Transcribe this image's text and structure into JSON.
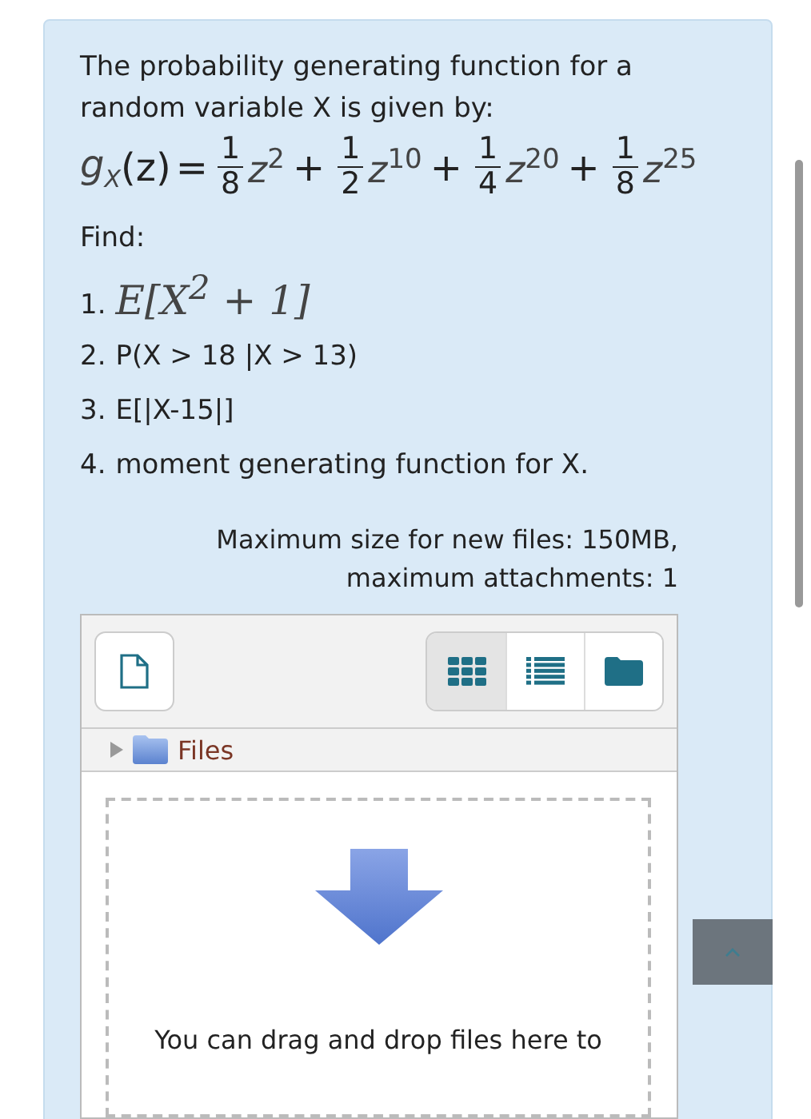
{
  "question": {
    "intro": "The probability generating function for a random variable X is given by:",
    "formula": {
      "func": "g",
      "sub": "X",
      "arg": "(z)",
      "equals": "=",
      "terms": [
        {
          "num": "1",
          "den": "8",
          "base": "z",
          "exp": "2"
        },
        {
          "operator": "+",
          "num": "1",
          "den": "2",
          "base": "z",
          "exp": "10"
        },
        {
          "operator": "+",
          "num": "1",
          "den": "4",
          "base": "z",
          "exp": "20"
        },
        {
          "operator": "+",
          "num": "1",
          "den": "8",
          "base": "z",
          "exp": "25"
        }
      ]
    },
    "find_label": "Find:",
    "items": [
      {
        "kind": "math",
        "number": "1.",
        "text": "E[X$^{2}$ + 1]"
      },
      {
        "kind": "plain",
        "number": "2.",
        "text": "P(X > 18 |X > 13)"
      },
      {
        "kind": "plain",
        "number": "3.",
        "text": "E[|X-15|]"
      },
      {
        "kind": "plain",
        "number": "4.",
        "text": "moment generating function for X."
      }
    ]
  },
  "upload_limits": "Maximum size for new files: 150MB, maximum attachments: 1",
  "file_picker": {
    "view_buttons": [
      {
        "kind": "icons",
        "selected": true
      },
      {
        "kind": "list",
        "selected": false
      },
      {
        "kind": "tree",
        "selected": false
      }
    ],
    "path": "Files",
    "drop_message": "You can drag and drop files here to"
  }
}
